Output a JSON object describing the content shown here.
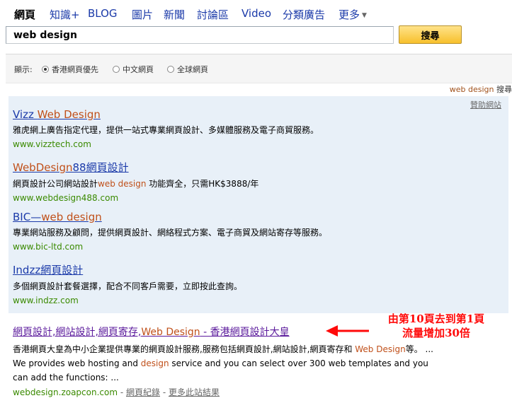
{
  "tabs": [
    {
      "label": "網頁"
    },
    {
      "label": "知識+"
    },
    {
      "label": "BLOG"
    },
    {
      "label": "圖片"
    },
    {
      "label": "新聞"
    },
    {
      "label": "討論區"
    },
    {
      "label": "Video"
    },
    {
      "label": "分類廣告"
    },
    {
      "label": "更多"
    }
  ],
  "search": {
    "value": "web design",
    "button_label": "搜尋"
  },
  "filter": {
    "label": "顯示:",
    "options": [
      {
        "label": "香港網頁優先",
        "selected": true
      },
      {
        "label": "中文網頁"
      },
      {
        "label": "全球網頁"
      }
    ]
  },
  "sponsor": {
    "query": "web design",
    "suffix": "搜尋",
    "help_label": "贊助網站"
  },
  "ads": [
    {
      "title_a": "Vizz ",
      "title_b": "Web Design",
      "title_c": "",
      "desc_a": "雅虎網上廣告指定代理，提供一站式專業網頁設計、多媒體服務及電子商貿服務。",
      "desc_b": "",
      "desc_c": "",
      "url": "www.vizztech.com"
    },
    {
      "title_a": "",
      "title_b": "WebDesign",
      "title_c": "88網頁設計",
      "desc_a": "網頁設計公司網站設計",
      "desc_b": "web design",
      "desc_c": " 功能齊全，只需HK$3888/年",
      "url": "www.webdesign488.com"
    },
    {
      "title_a": "BIC—",
      "title_b": "web design",
      "title_c": "",
      "desc_a": "專業網站服務及顧問，提供網頁設計、網絡程式方案、電子商貿及網站寄存等服務。",
      "desc_b": "",
      "desc_c": "",
      "url": "www.bic-ltd.com"
    },
    {
      "title_a": "Indzz網頁設計",
      "title_b": "",
      "title_c": "",
      "desc_a": "多個網頁設計套餐選擇，配合不同客戶需要，立即按此查詢。",
      "desc_b": "",
      "desc_c": "",
      "url": "www.indzz.com"
    }
  ],
  "organic": {
    "title_a": "網頁設計,網站設計,網頁寄存,",
    "title_b": "Web Design",
    "title_c": " - 香港網頁設計大皇",
    "desc_1": "香港網頁大皇為中小企業提供專業的網頁設計服務,服務包括網頁設計,網站設計,網頁寄存和 ",
    "desc_2": "Web Design",
    "desc_3": "等。 ... We provides web hosting and ",
    "desc_4": "design",
    "desc_5": " service and you can select over 300 web templates and you can add the functions: ...",
    "url": "webdesign.zoapcon.com",
    "sep1": " - ",
    "cache_label": "網頁紀錄",
    "sep2": " - ",
    "more_label": "更多此站結果"
  },
  "annotation": {
    "line1": "由第10頁去到第1頁",
    "line2": "流量增加30倍"
  },
  "colors": {
    "link": "#1b3aa9",
    "visited": "#5b1a9c",
    "url": "#3a8a00",
    "highlight": "#c0501a",
    "annotation": "#ff0a0a"
  }
}
